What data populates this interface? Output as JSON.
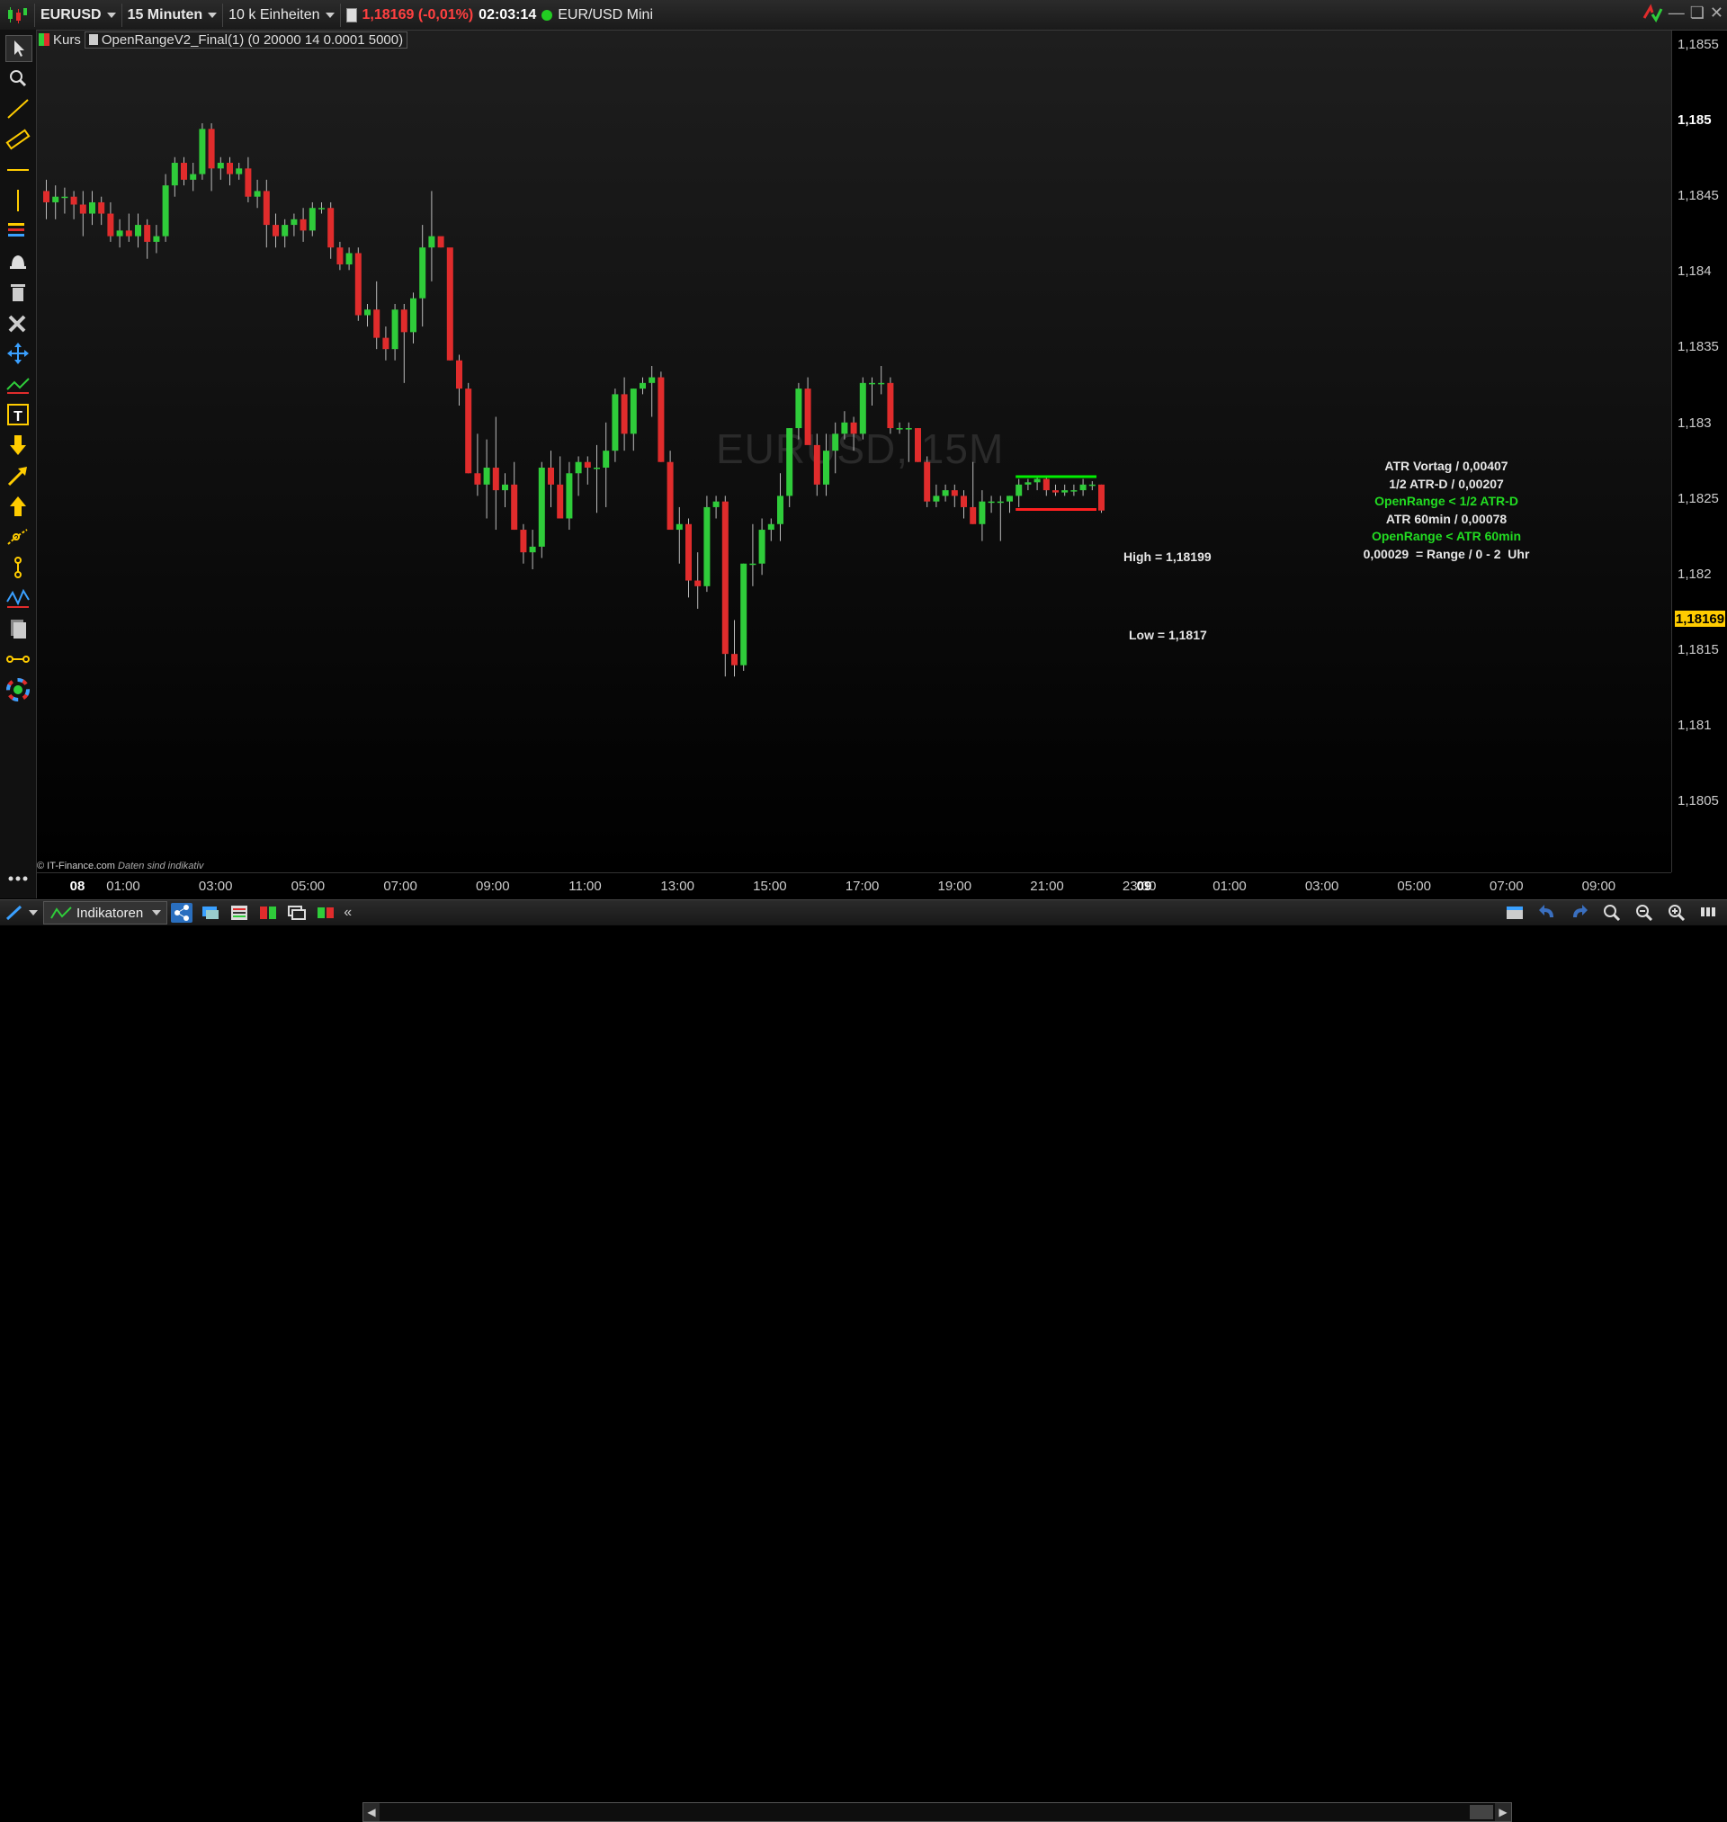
{
  "toolbar": {
    "symbol": "EURUSD",
    "timeframe": "15 Minuten",
    "units": "10 k Einheiten",
    "price_change": "1,18169 (-0,01%)",
    "time": "02:03:14",
    "instrument_name": "EUR/USD Mini"
  },
  "legend": {
    "price_label": "Kurs",
    "indicator_label": "OpenRangeV2_Final(1) (0 20000 14 0.0001 5000)"
  },
  "watermark": "EURUSD, 15M",
  "credit": {
    "source": "© IT-Finance.com",
    "note": "Daten sind indikativ"
  },
  "current_price": "1,18169",
  "annotations": {
    "high_label": "High = 1,18199",
    "low_label": "Low = 1,1817",
    "atr_vortag": "ATR Vortag / 0,00407",
    "half_atr": "1/2 ATR-D / 0,00207",
    "openrange_half": "OpenRange < 1/2 ATR-D",
    "atr_60": "ATR 60min / 0,00078",
    "openrange_60": "OpenRange < ATR 60min",
    "range_line": "0,00029  = Range / 0 - 2  Uhr"
  },
  "bottom": {
    "indicators_label": "Indikatoren"
  },
  "colors": {
    "up": "#2fcc3a",
    "down": "#e02c2c",
    "high_line": "#00ee00",
    "low_line": "#ff2020",
    "current_price_bg": "#ffcc00"
  },
  "chart_data": {
    "type": "candlestick",
    "y_ticks": [
      "1,1855",
      "1,185",
      "1,1845",
      "1,184",
      "1,1835",
      "1,183",
      "1,1825",
      "1,182",
      "1,1815",
      "1,181",
      "1,1805"
    ],
    "y_bold_tick": "1,185",
    "x_ticks": [
      {
        "label": "08",
        "day": true
      },
      {
        "label": "01:00"
      },
      {
        "label": "03:00"
      },
      {
        "label": "05:00"
      },
      {
        "label": "07:00"
      },
      {
        "label": "09:00"
      },
      {
        "label": "11:00"
      },
      {
        "label": "13:00"
      },
      {
        "label": "15:00"
      },
      {
        "label": "17:00"
      },
      {
        "label": "19:00"
      },
      {
        "label": "21:00"
      },
      {
        "label": "23:00"
      },
      {
        "label": "09",
        "day": true
      },
      {
        "label": "01:00"
      },
      {
        "label": "03:00"
      },
      {
        "label": "05:00"
      },
      {
        "label": "07:00"
      },
      {
        "label": "09:00"
      }
    ],
    "ylim": [
      1.18023,
      1.18575
    ],
    "open_range": {
      "high": 1.18199,
      "low": 1.1817
    },
    "candles": [
      [
        1.18452,
        1.18462,
        1.18427,
        1.18442
      ],
      [
        1.18442,
        1.18457,
        1.18427,
        1.18447
      ],
      [
        1.18447,
        1.18455,
        1.18432,
        1.18447
      ],
      [
        1.18447,
        1.18452,
        1.18427,
        1.1844
      ],
      [
        1.1844,
        1.18452,
        1.18412,
        1.18432
      ],
      [
        1.18432,
        1.18452,
        1.18422,
        1.18442
      ],
      [
        1.18442,
        1.18447,
        1.18422,
        1.18432
      ],
      [
        1.18432,
        1.18442,
        1.18407,
        1.18412
      ],
      [
        1.18412,
        1.18427,
        1.18402,
        1.18417
      ],
      [
        1.18417,
        1.18432,
        1.18407,
        1.18412
      ],
      [
        1.18412,
        1.18432,
        1.18402,
        1.18422
      ],
      [
        1.18422,
        1.18427,
        1.18392,
        1.18407
      ],
      [
        1.18407,
        1.18422,
        1.18397,
        1.18412
      ],
      [
        1.18412,
        1.18467,
        1.18407,
        1.18457
      ],
      [
        1.18457,
        1.18482,
        1.18447,
        1.18477
      ],
      [
        1.18477,
        1.18482,
        1.18457,
        1.18462
      ],
      [
        1.18462,
        1.18477,
        1.18452,
        1.18467
      ],
      [
        1.18467,
        1.18512,
        1.18462,
        1.18507
      ],
      [
        1.18507,
        1.18512,
        1.18452,
        1.18472
      ],
      [
        1.18472,
        1.18482,
        1.18462,
        1.18477
      ],
      [
        1.18477,
        1.18482,
        1.18457,
        1.18467
      ],
      [
        1.18467,
        1.18477,
        1.18462,
        1.18472
      ],
      [
        1.18472,
        1.18482,
        1.18442,
        1.18447
      ],
      [
        1.18447,
        1.18462,
        1.18437,
        1.18452
      ],
      [
        1.18452,
        1.18462,
        1.18402,
        1.18422
      ],
      [
        1.18422,
        1.18432,
        1.18402,
        1.18412
      ],
      [
        1.18412,
        1.18427,
        1.18402,
        1.18422
      ],
      [
        1.18422,
        1.18432,
        1.18412,
        1.18427
      ],
      [
        1.18427,
        1.18437,
        1.18407,
        1.18417
      ],
      [
        1.18417,
        1.18442,
        1.18412,
        1.18437
      ],
      [
        1.18437,
        1.18442,
        1.18432,
        1.18437
      ],
      [
        1.18437,
        1.18442,
        1.18392,
        1.18402
      ],
      [
        1.18402,
        1.18407,
        1.18382,
        1.18387
      ],
      [
        1.18387,
        1.18402,
        1.18382,
        1.18397
      ],
      [
        1.18397,
        1.18402,
        1.18337,
        1.18342
      ],
      [
        1.18342,
        1.18352,
        1.18332,
        1.18347
      ],
      [
        1.18347,
        1.18372,
        1.18312,
        1.18322
      ],
      [
        1.18322,
        1.18332,
        1.18302,
        1.18312
      ],
      [
        1.18312,
        1.18352,
        1.18302,
        1.18347
      ],
      [
        1.18347,
        1.18352,
        1.18282,
        1.18327
      ],
      [
        1.18327,
        1.18362,
        1.18317,
        1.18357
      ],
      [
        1.18357,
        1.18422,
        1.18332,
        1.18402
      ],
      [
        1.18402,
        1.18452,
        1.18372,
        1.18412
      ],
      [
        1.18412,
        1.18407,
        1.18402,
        1.18402
      ],
      [
        1.18402,
        1.18352,
        1.18302,
        1.18302
      ],
      [
        1.18302,
        1.18307,
        1.18262,
        1.18277
      ],
      [
        1.18277,
        1.18282,
        1.18202,
        1.18202
      ],
      [
        1.18202,
        1.18237,
        1.18182,
        1.18192
      ],
      [
        1.18192,
        1.18232,
        1.18162,
        1.18207
      ],
      [
        1.18207,
        1.18252,
        1.18152,
        1.18187
      ],
      [
        1.18187,
        1.18202,
        1.18172,
        1.18192
      ],
      [
        1.18192,
        1.18212,
        1.18152,
        1.18152
      ],
      [
        1.18152,
        1.18157,
        1.18122,
        1.18132
      ],
      [
        1.18132,
        1.18152,
        1.18117,
        1.18137
      ],
      [
        1.18137,
        1.18212,
        1.18127,
        1.18207
      ],
      [
        1.18207,
        1.18222,
        1.18172,
        1.18192
      ],
      [
        1.18192,
        1.18217,
        1.18162,
        1.18162
      ],
      [
        1.18162,
        1.18212,
        1.18152,
        1.18202
      ],
      [
        1.18202,
        1.18217,
        1.18182,
        1.18212
      ],
      [
        1.18212,
        1.18217,
        1.18192,
        1.18207
      ],
      [
        1.18207,
        1.18227,
        1.18167,
        1.18207
      ],
      [
        1.18207,
        1.18247,
        1.18172,
        1.18222
      ],
      [
        1.18222,
        1.18277,
        1.18212,
        1.18272
      ],
      [
        1.18272,
        1.18287,
        1.18222,
        1.18237
      ],
      [
        1.18237,
        1.18277,
        1.18222,
        1.18277
      ],
      [
        1.18277,
        1.18287,
        1.18272,
        1.18282
      ],
      [
        1.18282,
        1.18297,
        1.18252,
        1.18287
      ],
      [
        1.18287,
        1.18292,
        1.18212,
        1.18212
      ],
      [
        1.18212,
        1.18222,
        1.18162,
        1.18152
      ],
      [
        1.18152,
        1.18172,
        1.18122,
        1.18157
      ],
      [
        1.18157,
        1.18162,
        1.18092,
        1.18107
      ],
      [
        1.18107,
        1.18132,
        1.18082,
        1.18102
      ],
      [
        1.18102,
        1.18182,
        1.18097,
        1.18172
      ],
      [
        1.18172,
        1.18182,
        1.18162,
        1.18177
      ],
      [
        1.18177,
        1.18182,
        1.18022,
        1.18042
      ],
      [
        1.18042,
        1.18072,
        1.18022,
        1.18032
      ],
      [
        1.18032,
        1.18122,
        1.18027,
        1.18122
      ],
      [
        1.18122,
        1.18157,
        1.18102,
        1.18122
      ],
      [
        1.18122,
        1.18162,
        1.18112,
        1.18152
      ],
      [
        1.18152,
        1.18162,
        1.18142,
        1.18157
      ],
      [
        1.18157,
        1.18202,
        1.18142,
        1.18182
      ],
      [
        1.18182,
        1.18242,
        1.18172,
        1.18242
      ],
      [
        1.18242,
        1.18282,
        1.18232,
        1.18277
      ],
      [
        1.18277,
        1.18287,
        1.18252,
        1.18227
      ],
      [
        1.18227,
        1.18237,
        1.18182,
        1.18192
      ],
      [
        1.18192,
        1.18237,
        1.18182,
        1.18222
      ],
      [
        1.18222,
        1.18247,
        1.18202,
        1.18237
      ],
      [
        1.18237,
        1.18257,
        1.18232,
        1.18247
      ],
      [
        1.18247,
        1.18252,
        1.18222,
        1.18237
      ],
      [
        1.18237,
        1.18287,
        1.18232,
        1.18282
      ],
      [
        1.18282,
        1.18287,
        1.18262,
        1.18282
      ],
      [
        1.18282,
        1.18297,
        1.18272,
        1.18282
      ],
      [
        1.18282,
        1.18287,
        1.18237,
        1.18242
      ],
      [
        1.18242,
        1.18247,
        1.18237,
        1.18242
      ],
      [
        1.18242,
        1.18247,
        1.18212,
        1.18242
      ],
      [
        1.18242,
        1.18242,
        1.18212,
        1.18212
      ],
      [
        1.18212,
        1.18217,
        1.18172,
        1.18177
      ],
      [
        1.18177,
        1.18192,
        1.18172,
        1.18182
      ],
      [
        1.18182,
        1.18192,
        1.18177,
        1.18187
      ],
      [
        1.18187,
        1.18192,
        1.18172,
        1.18182
      ],
      [
        1.18182,
        1.18187,
        1.18162,
        1.18172
      ],
      [
        1.18172,
        1.18212,
        1.18157,
        1.18157
      ],
      [
        1.18157,
        1.18187,
        1.18142,
        1.18177
      ],
      [
        1.18177,
        1.18182,
        1.18167,
        1.18177
      ],
      [
        1.18177,
        1.18182,
        1.18142,
        1.18177
      ],
      [
        1.18177,
        1.18182,
        1.18167,
        1.18182
      ],
      [
        1.18182,
        1.18197,
        1.18172,
        1.18192
      ],
      [
        1.18192,
        1.18197,
        1.18187,
        1.18194
      ],
      [
        1.18194,
        1.18199,
        1.18187,
        1.18197
      ],
      [
        1.18197,
        1.18199,
        1.18182,
        1.18187
      ],
      [
        1.18187,
        1.18192,
        1.18182,
        1.18185
      ],
      [
        1.18185,
        1.18192,
        1.18182,
        1.18187
      ],
      [
        1.18187,
        1.18192,
        1.18182,
        1.18187
      ],
      [
        1.18187,
        1.18197,
        1.18182,
        1.18192
      ],
      [
        1.18192,
        1.18195,
        1.18187,
        1.18192
      ],
      [
        1.18192,
        1.18192,
        1.18167,
        1.18169
      ]
    ]
  }
}
